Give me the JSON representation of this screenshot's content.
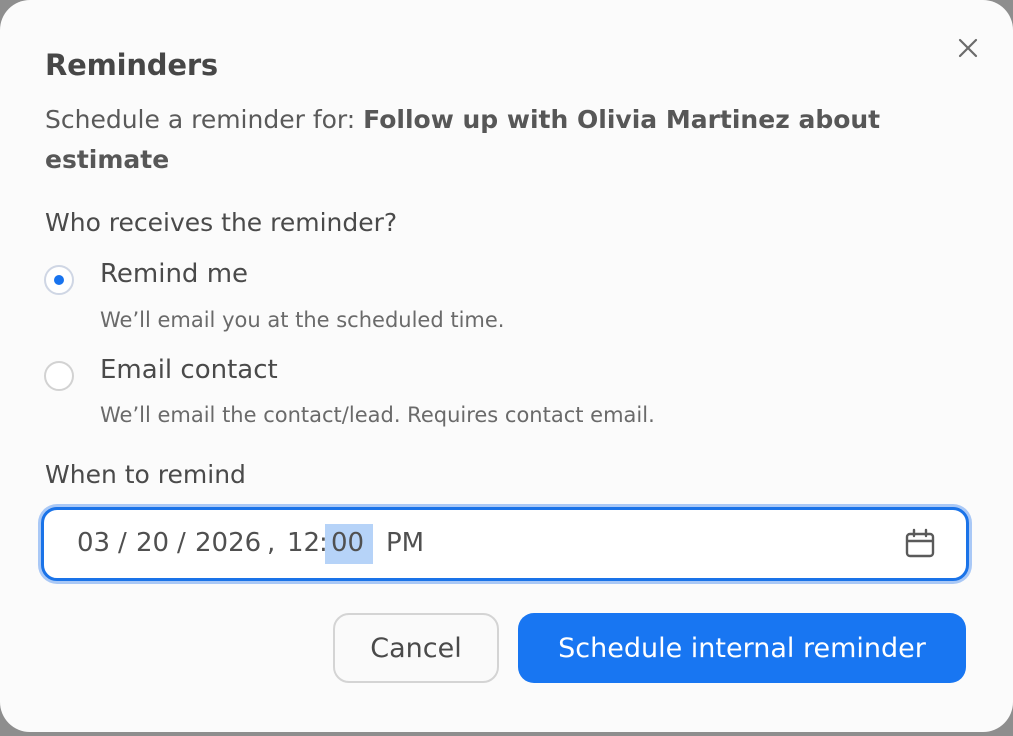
{
  "dialog": {
    "title": "Reminders",
    "subtitle_prefix": "Schedule a reminder for: ",
    "task_name": "Follow up with Olivia Martinez about estimate"
  },
  "recipient": {
    "label": "Who receives the reminder?",
    "options": [
      {
        "label": "Remind me",
        "help": "We’ll email you at the scheduled time.",
        "selected": true
      },
      {
        "label": "Email contact",
        "help": "We’ll email the contact/lead. Requires contact email.",
        "selected": false
      }
    ]
  },
  "when": {
    "label": "When to remind",
    "month": "03",
    "sep1": "/",
    "day": "20",
    "sep2": "/",
    "year": "2026",
    "comma": ",",
    "hour": "12",
    "colon": ":",
    "minute": "00",
    "ampm": "PM",
    "focused_segment": "minute"
  },
  "actions": {
    "cancel_label": "Cancel",
    "submit_label": "Schedule internal reminder"
  },
  "colors": {
    "accent": "#1876f2",
    "focus_ring": "#a9c8f6",
    "selection": "#b6d3f8"
  },
  "icons": {
    "close": "close-icon",
    "calendar": "calendar-icon"
  }
}
